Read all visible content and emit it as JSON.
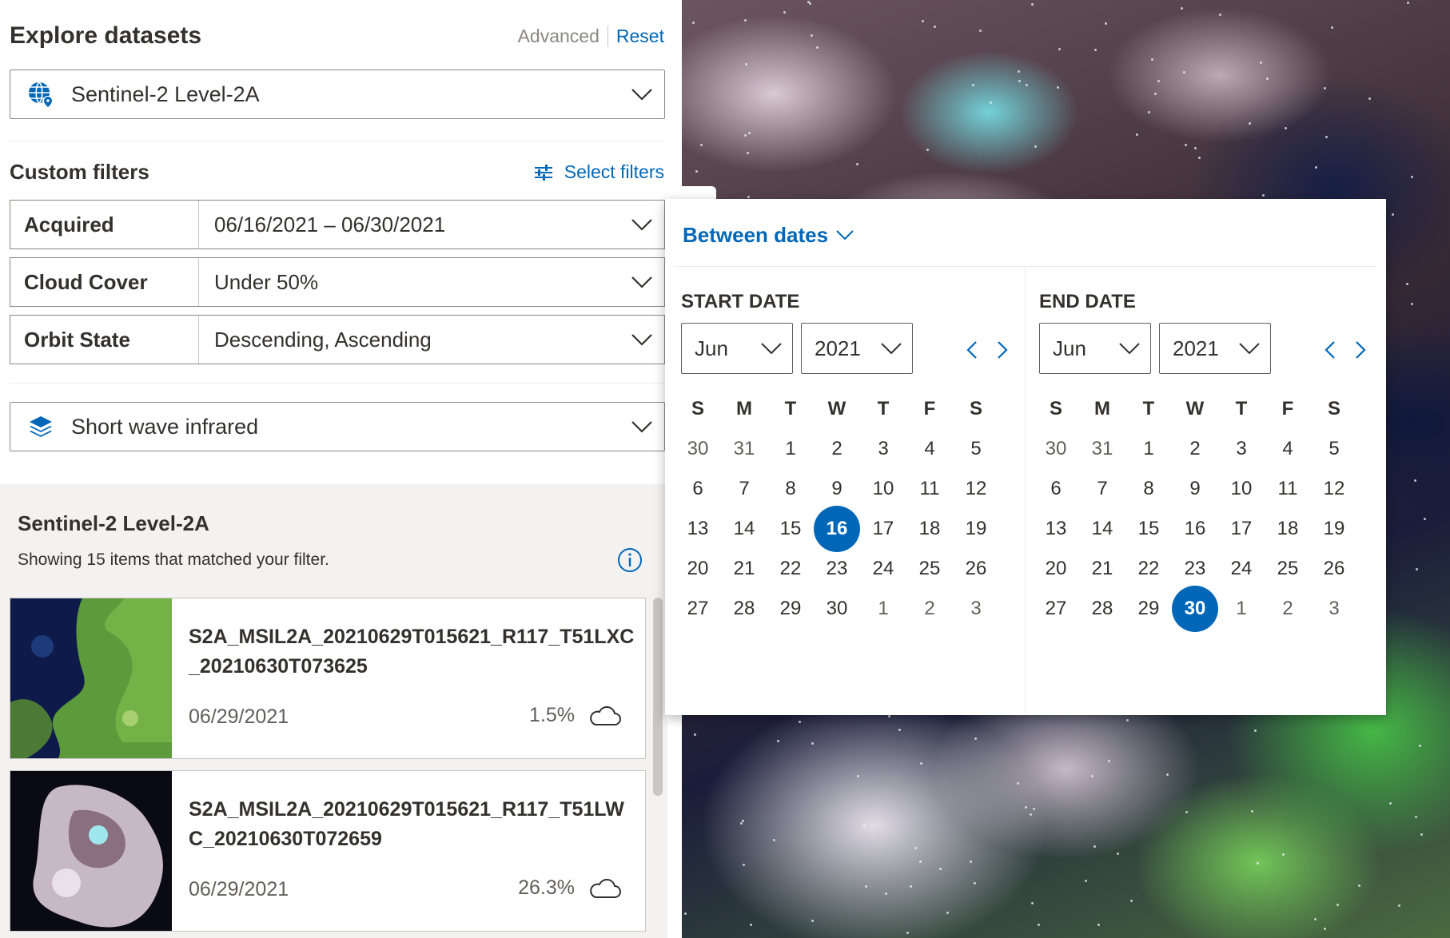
{
  "header": {
    "title": "Explore datasets",
    "advanced_label": "Advanced",
    "reset_label": "Reset"
  },
  "dataset_select": {
    "value": "Sentinel-2 Level-2A",
    "icon": "globe-icon"
  },
  "custom_filters": {
    "title": "Custom filters",
    "select_filters_label": "Select filters",
    "rows": [
      {
        "label": "Acquired",
        "value": "06/16/2021 – 06/30/2021"
      },
      {
        "label": "Cloud Cover",
        "value": "Under 50%"
      },
      {
        "label": "Orbit State",
        "value": "Descending, Ascending"
      }
    ]
  },
  "render_select": {
    "value": "Short wave infrared",
    "icon": "layers-icon"
  },
  "results": {
    "title": "Sentinel-2 Level-2A",
    "subtitle": "Showing 15 items that matched your filter.",
    "items": [
      {
        "name": "S2A_MSIL2A_20210629T015621_R117_T51LXC_20210630T073625",
        "date": "06/29/2021",
        "cloud": "1.5%"
      },
      {
        "name": "S2A_MSIL2A_20210629T015621_R117_T51LWC_20210630T072659",
        "date": "06/29/2021",
        "cloud": "26.3%"
      }
    ]
  },
  "date_popup": {
    "mode_label": "Between dates",
    "start": {
      "title": "START DATE",
      "month": "Jun",
      "year": "2021",
      "selected_day": "16"
    },
    "end": {
      "title": "END DATE",
      "month": "Jun",
      "year": "2021",
      "selected_day": "30"
    },
    "weekdays": [
      "S",
      "M",
      "T",
      "W",
      "T",
      "F",
      "S"
    ],
    "weeks": [
      [
        "30",
        "31",
        "1",
        "2",
        "3",
        "4",
        "5"
      ],
      [
        "6",
        "7",
        "8",
        "9",
        "10",
        "11",
        "12"
      ],
      [
        "13",
        "14",
        "15",
        "16",
        "17",
        "18",
        "19"
      ],
      [
        "20",
        "21",
        "22",
        "23",
        "24",
        "25",
        "26"
      ],
      [
        "27",
        "28",
        "29",
        "30",
        "1",
        "2",
        "3"
      ]
    ]
  },
  "colors": {
    "accent": "#0067b8",
    "text": "#323130",
    "muted": "#605e5c"
  }
}
